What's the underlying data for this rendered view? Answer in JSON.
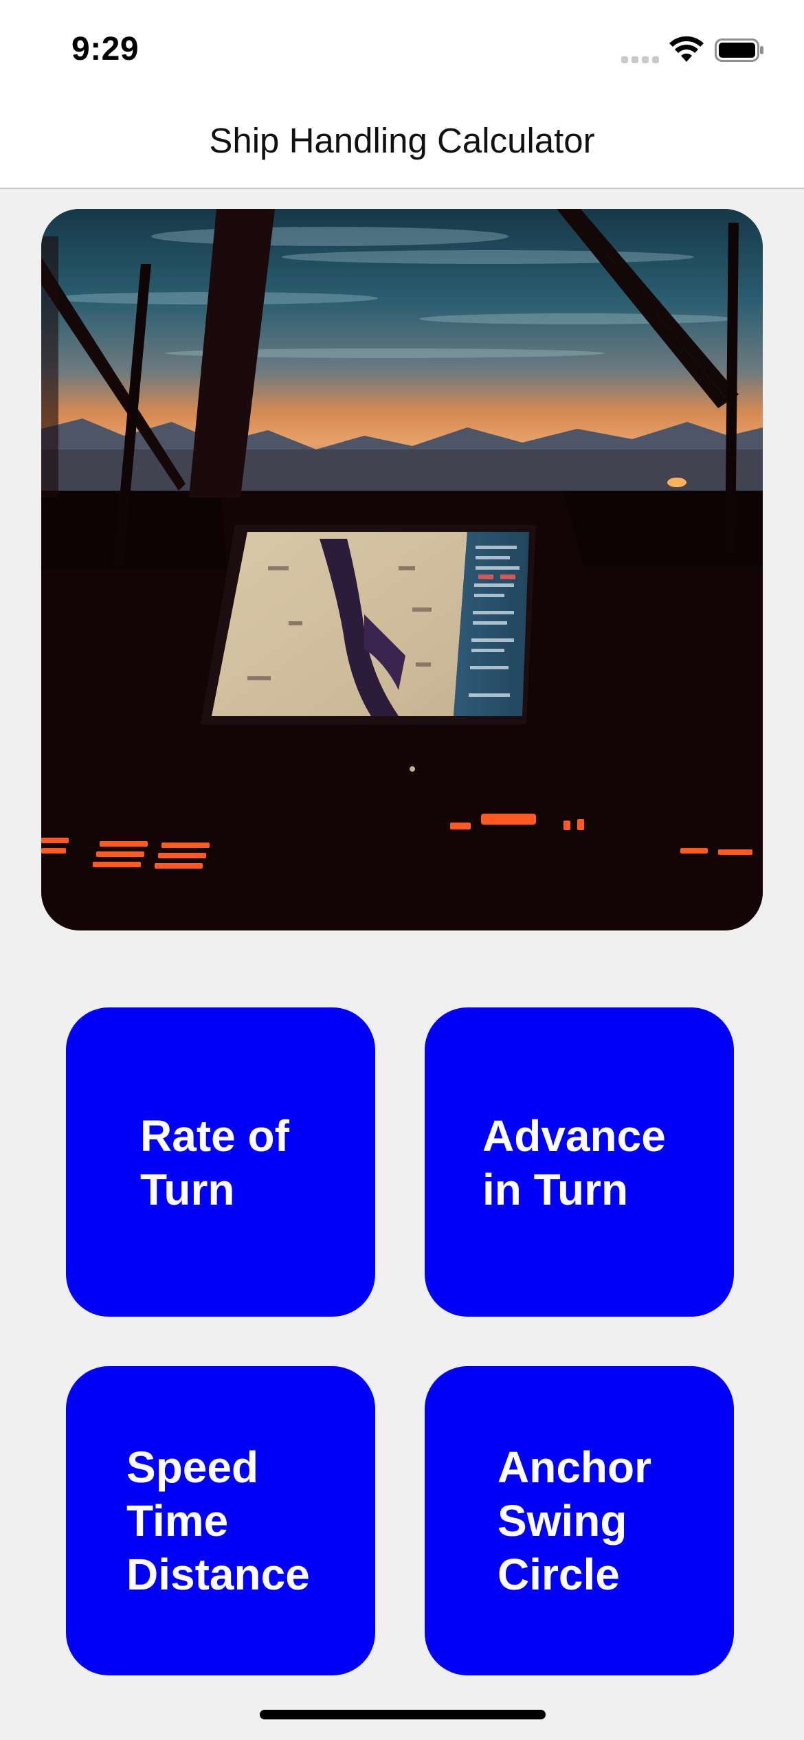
{
  "status_bar": {
    "time": "9:29",
    "icons": [
      "cellular-signal-icon",
      "wifi-icon",
      "battery-icon"
    ]
  },
  "nav": {
    "title": "Ship Handling Calculator"
  },
  "hero_image": {
    "description_icon": "ship-bridge-photo"
  },
  "tiles": [
    {
      "id": "rate-of-turn",
      "label": "Rate of\nTurn"
    },
    {
      "id": "advance-in-turn",
      "label": "Advance\nin Turn"
    },
    {
      "id": "speed-time-distance",
      "label": "Speed\nTime\nDistance"
    },
    {
      "id": "anchor-swing-circle",
      "label": "Anchor\nSwing\nCircle"
    }
  ],
  "colors": {
    "tile_background": "#0000fa",
    "tile_text": "#ffffff",
    "page_background": "#f0f0f0"
  }
}
